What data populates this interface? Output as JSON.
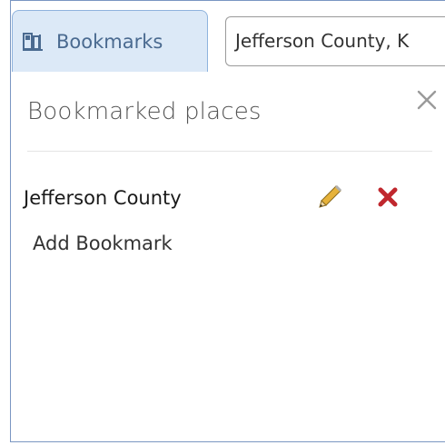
{
  "toolbar": {
    "bookmarks_tab_label": "Bookmarks",
    "search_value": "Jefferson County, K"
  },
  "panel": {
    "title": "Bookmarked places",
    "bookmarks": [
      {
        "name": "Jefferson County"
      }
    ],
    "add_label": "Add Bookmark"
  },
  "colors": {
    "tab_bg": "#dce9f7",
    "tab_border": "#8fb3dd",
    "tab_text": "#4a6a90",
    "delete": "#c0282e",
    "pencil": "#e0b030"
  },
  "icons": {
    "tab": "bookmark-book-icon",
    "edit": "pencil-icon",
    "delete": "x-icon",
    "close": "close-icon"
  }
}
